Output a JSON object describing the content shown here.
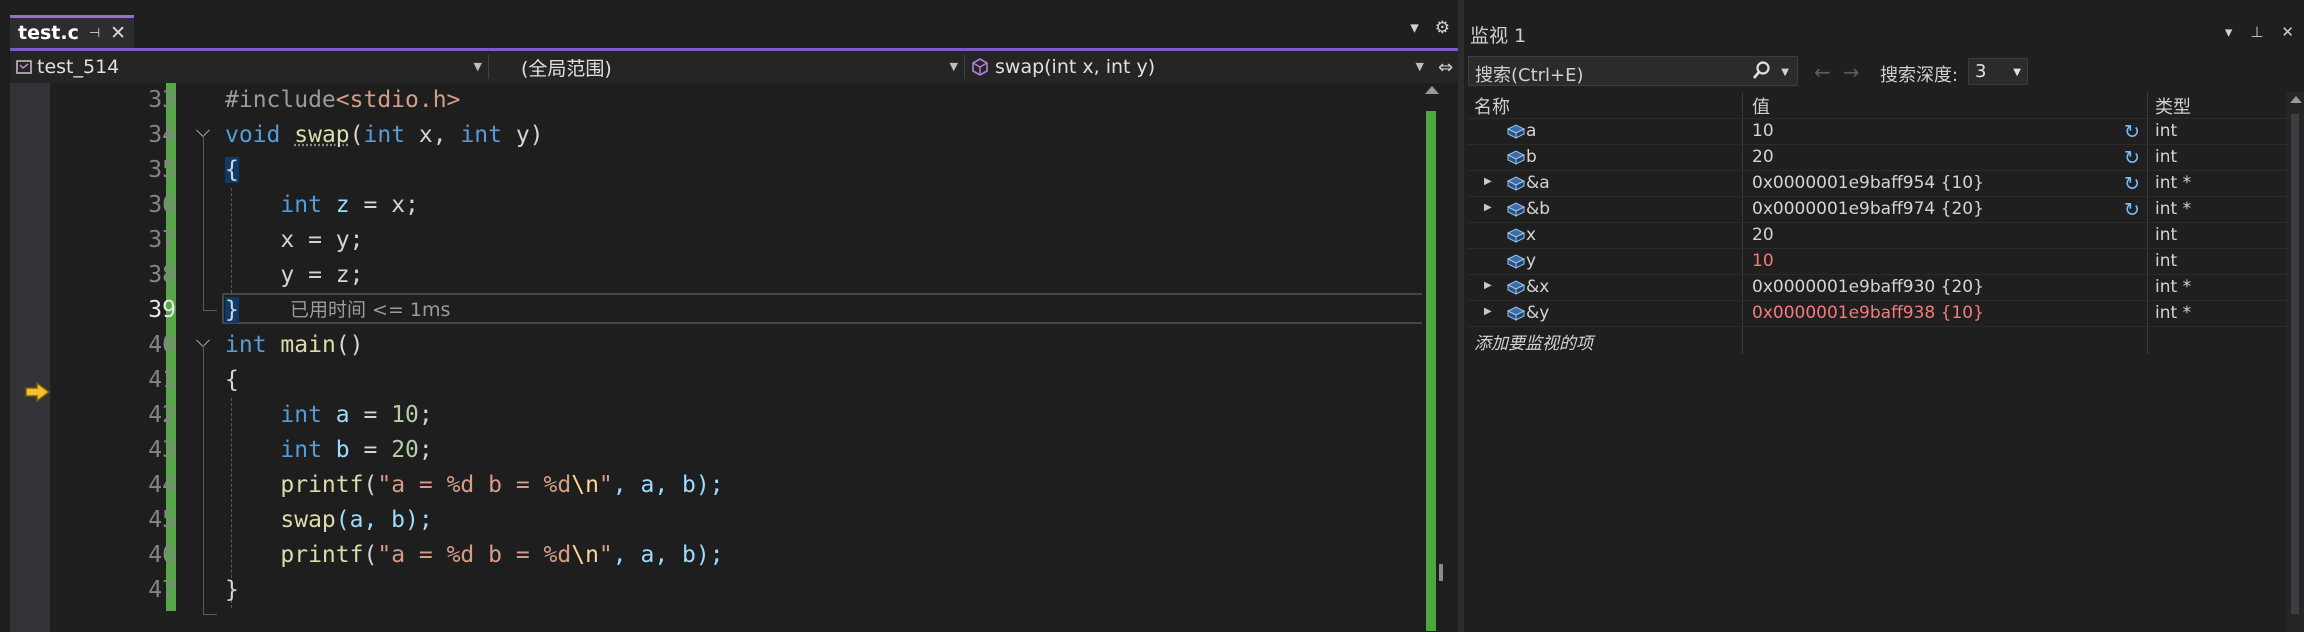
{
  "editor": {
    "tab": {
      "filename": "test.c"
    },
    "nav": {
      "project": "test_514",
      "scope": "(全局范围)",
      "member": "swap(int x, int y)"
    },
    "line_numbers": [
      "33",
      "34",
      "35",
      "36",
      "37",
      "38",
      "39",
      "40",
      "41",
      "42",
      "43",
      "44",
      "45",
      "46",
      "47"
    ],
    "current_line": "39",
    "code": {
      "l33": {
        "pp": "#include",
        "inc": "<stdio.h>"
      },
      "l34": {
        "kw1": "void",
        "fn": "swap",
        "p1": "(",
        "kw2": "int",
        "a1": " x, ",
        "kw3": "int",
        "a2": " y)"
      },
      "l35": {
        "t": "{"
      },
      "l36": {
        "kw": "int",
        "v": "z",
        "rest": " = x;"
      },
      "l37": {
        "t": "x = y;"
      },
      "l38": {
        "t": "y = z;"
      },
      "l39": {
        "t": "}"
      },
      "l40": {
        "kw": "int",
        "fn": "main",
        "rest": "()"
      },
      "l41": {
        "t": "{"
      },
      "l42": {
        "kw": "int",
        "v": "a",
        "eq": " = ",
        "num": "10",
        "end": ";"
      },
      "l43": {
        "kw": "int",
        "v": "b",
        "eq": " = ",
        "num": "20",
        "end": ";"
      },
      "l44": {
        "fn": "printf",
        "p": "(",
        "s1": "\"a = %d b = %d",
        "esc": "\\n",
        "s2": "\"",
        "rest": ", a, b);"
      },
      "l45": {
        "fn": "swap",
        "rest": "(a, b);"
      },
      "l46": {
        "fn": "printf",
        "p": "(",
        "s1": "\"a = %d b = %d",
        "esc": "\\n",
        "s2": "\"",
        "rest": ", a, b);"
      },
      "l47": {
        "t": "}"
      }
    },
    "elapsed": "已用时间 <= 1ms"
  },
  "watch": {
    "title": "监视 1",
    "search_placeholder": "搜索(Ctrl+E)",
    "depth_label": "搜索深度:",
    "depth_value": "3",
    "columns": {
      "name": "名称",
      "value": "值",
      "type": "类型"
    },
    "rows": [
      {
        "name": "a",
        "value": "10",
        "type": "int",
        "expandable": false,
        "changed": false,
        "refresh": true
      },
      {
        "name": "b",
        "value": "20",
        "type": "int",
        "expandable": false,
        "changed": false,
        "refresh": true
      },
      {
        "name": "&a",
        "value": "0x0000001e9baff954 {10}",
        "type": "int *",
        "expandable": true,
        "changed": false,
        "refresh": true
      },
      {
        "name": "&b",
        "value": "0x0000001e9baff974 {20}",
        "type": "int *",
        "expandable": true,
        "changed": false,
        "refresh": true
      },
      {
        "name": "x",
        "value": "20",
        "type": "int",
        "expandable": false,
        "changed": false,
        "refresh": false
      },
      {
        "name": "y",
        "value": "10",
        "type": "int",
        "expandable": false,
        "changed": true,
        "refresh": false
      },
      {
        "name": "&x",
        "value": "0x0000001e9baff930 {20}",
        "type": "int *",
        "expandable": true,
        "changed": false,
        "refresh": false
      },
      {
        "name": "&y",
        "value": "0x0000001e9baff938 {10}",
        "type": "int *",
        "expandable": true,
        "changed": true,
        "refresh": false
      }
    ],
    "add_item": "添加要监视的项"
  },
  "colors": {
    "accent": "#7c5cc4",
    "changed": "#f47b7b",
    "modified_bar": "#57a64a",
    "keyword": "#569cd6"
  }
}
